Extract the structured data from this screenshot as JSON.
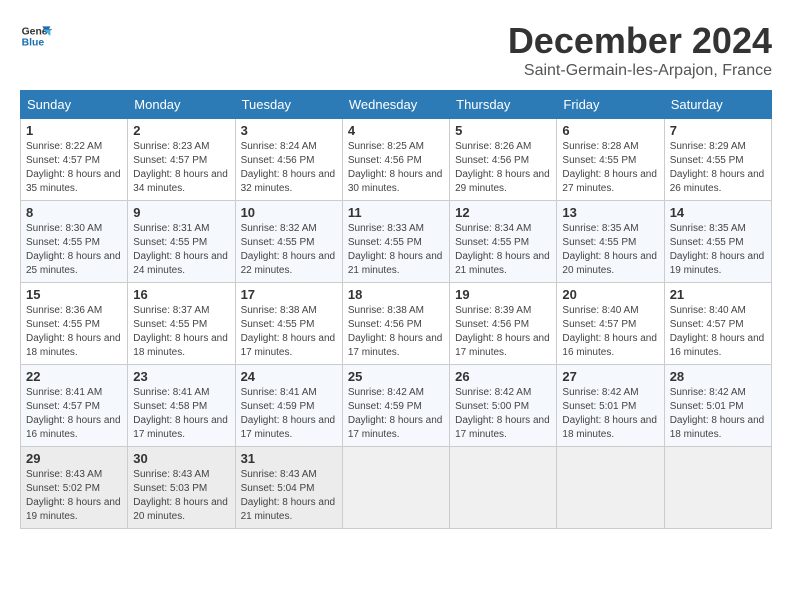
{
  "logo": {
    "line1": "General",
    "line2": "Blue"
  },
  "header": {
    "month": "December 2024",
    "location": "Saint-Germain-les-Arpajon, France"
  },
  "weekdays": [
    "Sunday",
    "Monday",
    "Tuesday",
    "Wednesday",
    "Thursday",
    "Friday",
    "Saturday"
  ],
  "weeks": [
    [
      {
        "day": "1",
        "sunrise": "8:22 AM",
        "sunset": "4:57 PM",
        "daylight": "8 hours and 35 minutes."
      },
      {
        "day": "2",
        "sunrise": "8:23 AM",
        "sunset": "4:57 PM",
        "daylight": "8 hours and 34 minutes."
      },
      {
        "day": "3",
        "sunrise": "8:24 AM",
        "sunset": "4:56 PM",
        "daylight": "8 hours and 32 minutes."
      },
      {
        "day": "4",
        "sunrise": "8:25 AM",
        "sunset": "4:56 PM",
        "daylight": "8 hours and 30 minutes."
      },
      {
        "day": "5",
        "sunrise": "8:26 AM",
        "sunset": "4:56 PM",
        "daylight": "8 hours and 29 minutes."
      },
      {
        "day": "6",
        "sunrise": "8:28 AM",
        "sunset": "4:55 PM",
        "daylight": "8 hours and 27 minutes."
      },
      {
        "day": "7",
        "sunrise": "8:29 AM",
        "sunset": "4:55 PM",
        "daylight": "8 hours and 26 minutes."
      }
    ],
    [
      {
        "day": "8",
        "sunrise": "8:30 AM",
        "sunset": "4:55 PM",
        "daylight": "8 hours and 25 minutes."
      },
      {
        "day": "9",
        "sunrise": "8:31 AM",
        "sunset": "4:55 PM",
        "daylight": "8 hours and 24 minutes."
      },
      {
        "day": "10",
        "sunrise": "8:32 AM",
        "sunset": "4:55 PM",
        "daylight": "8 hours and 22 minutes."
      },
      {
        "day": "11",
        "sunrise": "8:33 AM",
        "sunset": "4:55 PM",
        "daylight": "8 hours and 21 minutes."
      },
      {
        "day": "12",
        "sunrise": "8:34 AM",
        "sunset": "4:55 PM",
        "daylight": "8 hours and 21 minutes."
      },
      {
        "day": "13",
        "sunrise": "8:35 AM",
        "sunset": "4:55 PM",
        "daylight": "8 hours and 20 minutes."
      },
      {
        "day": "14",
        "sunrise": "8:35 AM",
        "sunset": "4:55 PM",
        "daylight": "8 hours and 19 minutes."
      }
    ],
    [
      {
        "day": "15",
        "sunrise": "8:36 AM",
        "sunset": "4:55 PM",
        "daylight": "8 hours and 18 minutes."
      },
      {
        "day": "16",
        "sunrise": "8:37 AM",
        "sunset": "4:55 PM",
        "daylight": "8 hours and 18 minutes."
      },
      {
        "day": "17",
        "sunrise": "8:38 AM",
        "sunset": "4:55 PM",
        "daylight": "8 hours and 17 minutes."
      },
      {
        "day": "18",
        "sunrise": "8:38 AM",
        "sunset": "4:56 PM",
        "daylight": "8 hours and 17 minutes."
      },
      {
        "day": "19",
        "sunrise": "8:39 AM",
        "sunset": "4:56 PM",
        "daylight": "8 hours and 17 minutes."
      },
      {
        "day": "20",
        "sunrise": "8:40 AM",
        "sunset": "4:57 PM",
        "daylight": "8 hours and 16 minutes."
      },
      {
        "day": "21",
        "sunrise": "8:40 AM",
        "sunset": "4:57 PM",
        "daylight": "8 hours and 16 minutes."
      }
    ],
    [
      {
        "day": "22",
        "sunrise": "8:41 AM",
        "sunset": "4:57 PM",
        "daylight": "8 hours and 16 minutes."
      },
      {
        "day": "23",
        "sunrise": "8:41 AM",
        "sunset": "4:58 PM",
        "daylight": "8 hours and 17 minutes."
      },
      {
        "day": "24",
        "sunrise": "8:41 AM",
        "sunset": "4:59 PM",
        "daylight": "8 hours and 17 minutes."
      },
      {
        "day": "25",
        "sunrise": "8:42 AM",
        "sunset": "4:59 PM",
        "daylight": "8 hours and 17 minutes."
      },
      {
        "day": "26",
        "sunrise": "8:42 AM",
        "sunset": "5:00 PM",
        "daylight": "8 hours and 17 minutes."
      },
      {
        "day": "27",
        "sunrise": "8:42 AM",
        "sunset": "5:01 PM",
        "daylight": "8 hours and 18 minutes."
      },
      {
        "day": "28",
        "sunrise": "8:42 AM",
        "sunset": "5:01 PM",
        "daylight": "8 hours and 18 minutes."
      }
    ],
    [
      {
        "day": "29",
        "sunrise": "8:43 AM",
        "sunset": "5:02 PM",
        "daylight": "8 hours and 19 minutes."
      },
      {
        "day": "30",
        "sunrise": "8:43 AM",
        "sunset": "5:03 PM",
        "daylight": "8 hours and 20 minutes."
      },
      {
        "day": "31",
        "sunrise": "8:43 AM",
        "sunset": "5:04 PM",
        "daylight": "8 hours and 21 minutes."
      },
      null,
      null,
      null,
      null
    ]
  ]
}
